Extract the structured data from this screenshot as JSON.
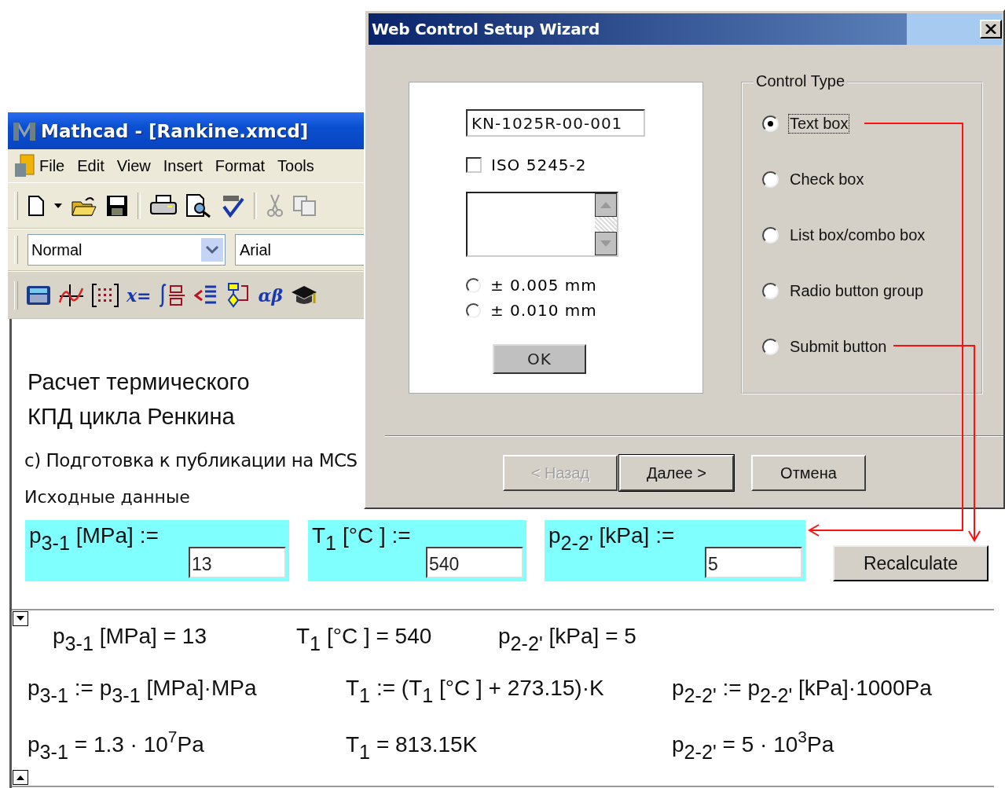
{
  "mathcad": {
    "title": "Mathcad - [Rankine.xmcd]",
    "menu": [
      "File",
      "Edit",
      "View",
      "Insert",
      "Format",
      "Tools"
    ],
    "style_box": {
      "value": "Normal"
    },
    "font_box": {
      "value": "Arial"
    },
    "math_toolbar": {
      "evaluation": "x=",
      "greek": "αβ"
    }
  },
  "document": {
    "heading": [
      "Расчет термического",
      "КПД цикла Ренкина"
    ],
    "subheading": "с) Подготовка к публикации на MCS",
    "section": "Исходные данные",
    "inputs": [
      {
        "label": "p$_{3-1}$ [MPa] :=",
        "value": "13"
      },
      {
        "label": "T$_{1}$ [°C ] :=",
        "value": "540"
      },
      {
        "label": "p$_{2-2'}$ [kPa] :=",
        "value": "5"
      }
    ],
    "recalculate": "Recalculate",
    "results": [
      [
        "p$_{3-1}$ [MPa] = 13",
        "T$_{1}$ [°C ] = 540",
        "p$_{2-2'}$ [kPa] = 5"
      ],
      [
        "p$_{3-1}$ := p$_{3-1}$ [MPa]·MPa",
        "T$_{1}$ := (T$_{1}$ [°C ] + 273.15)·K",
        "p$_{2-2'}$ := p$_{2-2'}$ [kPa]·1000Pa"
      ],
      [
        "p$_{3-1}$ = 1.3 · 10$^{7}$Pa",
        "T$_{1}$ = 813.15K",
        "p$_{2-2'}$ = 5 · 10$^{3}$Pa"
      ]
    ]
  },
  "dialog": {
    "title": "Web Control Setup Wizard",
    "preview": {
      "text_field": "KN-1025R-00-001",
      "checkbox": {
        "label": "ISO 5245-2",
        "checked": false
      },
      "radios": [
        {
          "label": "± 0.005 mm",
          "selected": false
        },
        {
          "label": "± 0.010 mm",
          "selected": false
        }
      ],
      "ok": "OK"
    },
    "control_type": {
      "legend": "Control Type",
      "options": [
        {
          "label": "Text box",
          "selected": true,
          "focused": true
        },
        {
          "label": "Check box",
          "selected": false,
          "focused": false
        },
        {
          "label": "List box/combo box",
          "selected": false,
          "focused": false
        },
        {
          "label": "Radio button group",
          "selected": false,
          "focused": false
        },
        {
          "label": "Submit button",
          "selected": false,
          "focused": false
        }
      ]
    },
    "buttons": [
      {
        "label": "< Назад",
        "disabled": true,
        "default": false
      },
      {
        "label": "Далее >",
        "disabled": false,
        "default": true
      },
      {
        "label": "Отмена",
        "disabled": false,
        "default": false
      }
    ]
  }
}
